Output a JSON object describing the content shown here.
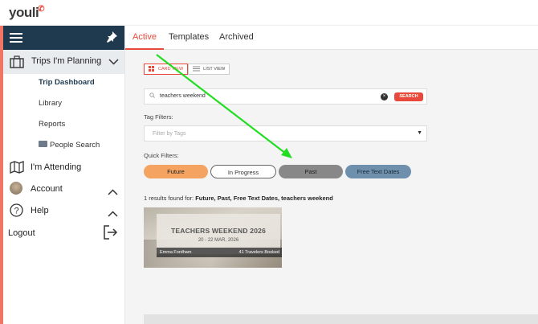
{
  "app": {
    "logo_text": "youli",
    "logo_mark": "✆"
  },
  "sidebar": {
    "menu_icon": "hamburger-icon",
    "pin_icon": "pin-icon",
    "trips_label": "Trips I'm Planning",
    "sub_items": [
      {
        "label": "Trip Dashboard",
        "active": true
      },
      {
        "label": "Library"
      },
      {
        "label": "Reports"
      },
      {
        "label": "People Search",
        "badge": "NEW"
      }
    ],
    "attending_label": "I'm Attending",
    "account_label": "Account",
    "help_label": "Help",
    "logout_label": "Logout"
  },
  "tabs": [
    {
      "label": "Active",
      "active": true
    },
    {
      "label": "Templates"
    },
    {
      "label": "Archived"
    }
  ],
  "view_toggle": {
    "card_label": "CARD VIEW",
    "list_label": "LIST VIEW",
    "selected": "card"
  },
  "search": {
    "value": "teachers weekend",
    "button_label": "SEARCH"
  },
  "tag_filters": {
    "label": "Tag Filters:",
    "placeholder": "Filter by Tags"
  },
  "quick_filters": {
    "label": "Quick Filters:",
    "items": [
      {
        "label": "Future",
        "bg": "#f4a460",
        "color": "#222"
      },
      {
        "label": "In Progress",
        "bg": "#ffffff",
        "color": "#333"
      },
      {
        "label": "Past",
        "bg": "#888888",
        "color": "#222"
      },
      {
        "label": "Free Text Dates",
        "bg": "#6f90ad",
        "color": "#1b2a3a"
      }
    ]
  },
  "results": {
    "prefix": "1 results found for: ",
    "query": "Future, Past, Free Text Dates, teachers weekend"
  },
  "trip_card": {
    "title": "TEACHERS WEEKEND 2026",
    "dates": "20 - 22 MAR, 2026",
    "organizer": "Emma Fordham",
    "travelers": "41 Travelers Booked"
  },
  "colors": {
    "accent": "#e8493a",
    "sidebar_header": "#1f3a4f",
    "annotation_arrow": "#22dd22"
  }
}
